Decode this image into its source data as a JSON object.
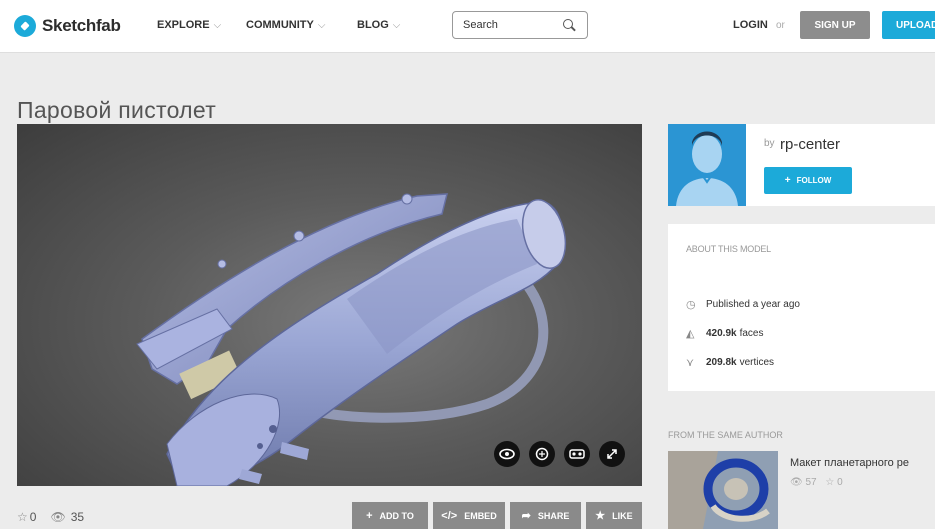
{
  "header": {
    "logo_text": "Sketchfab",
    "nav": [
      {
        "label": "EXPLORE"
      },
      {
        "label": "COMMUNITY"
      },
      {
        "label": "BLOG"
      }
    ],
    "search_placeholder": "Search",
    "login": "LOGIN",
    "or": "or",
    "signup": "SIGN UP",
    "upload": "UPLOAD"
  },
  "model": {
    "title": "Паровой пистолет",
    "likes": "0",
    "views": "35",
    "actions": [
      "ADD TO",
      "EMBED",
      "SHARE",
      "LIKE"
    ]
  },
  "author": {
    "by": "by",
    "name": "rp-center",
    "follow": "FOLLOW"
  },
  "about": {
    "header": "ABOUT THIS MODEL",
    "published": "Published a year ago",
    "faces_value": "420.9k",
    "faces_label": "faces",
    "vertices_value": "209.8k",
    "vertices_label": "vertices"
  },
  "same_author": {
    "header": "FROM THE SAME AUTHOR",
    "title": "Макет планетарного ре",
    "views": "57",
    "likes": "0"
  },
  "colors": {
    "brand": "#1caad9",
    "signup": "#8d8d8d",
    "action_button": "#8a8a8a",
    "page_bg": "#ececec"
  }
}
